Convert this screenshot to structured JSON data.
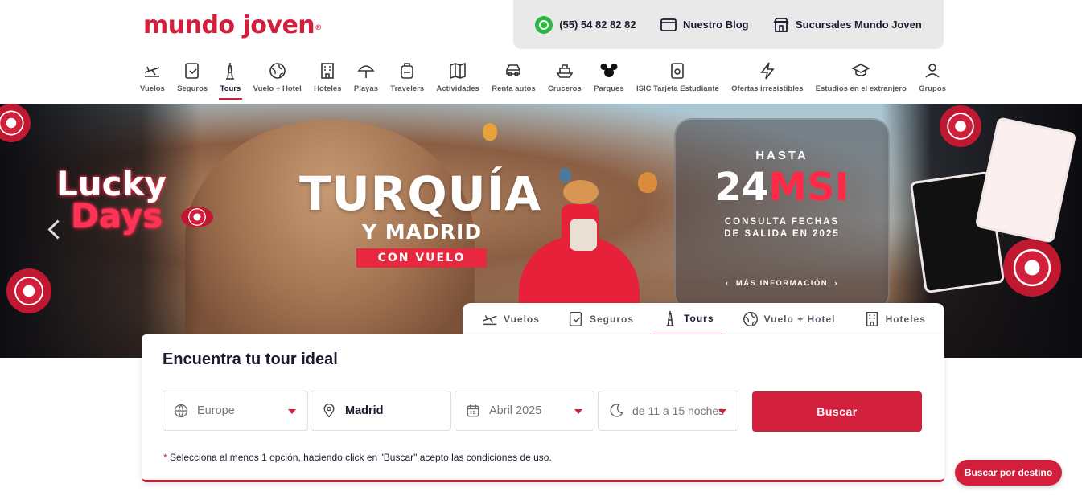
{
  "brand": {
    "logo_text": "mundo joven",
    "registered": "®"
  },
  "topbar": {
    "phone": "(55) 54 82 82 82",
    "blog": "Nuestro Blog",
    "branches": "Sucursales Mundo Joven"
  },
  "nav": {
    "items": [
      {
        "label": "Vuelos",
        "icon": "plane-icon"
      },
      {
        "label": "Seguros",
        "icon": "insurance-icon"
      },
      {
        "label": "Tours",
        "icon": "eiffel-tower-icon",
        "active": true
      },
      {
        "label": "Vuelo + Hotel",
        "icon": "globe-icon"
      },
      {
        "label": "Hoteles",
        "icon": "hotel-icon"
      },
      {
        "label": "Playas",
        "icon": "umbrella-icon"
      },
      {
        "label": "Travelers",
        "icon": "backpack-icon"
      },
      {
        "label": "Actividades",
        "icon": "map-icon"
      },
      {
        "label": "Renta autos",
        "icon": "car-icon"
      },
      {
        "label": "Cruceros",
        "icon": "ship-icon"
      },
      {
        "label": "Parques",
        "icon": "mouse-ears-icon"
      },
      {
        "label": "ISIC Tarjeta Estudiante",
        "icon": "student-card-icon"
      },
      {
        "label": "Ofertas irresistibles",
        "icon": "lightning-icon"
      },
      {
        "label": "Estudios en el extranjero",
        "icon": "graduation-cap-icon"
      },
      {
        "label": "Grupos",
        "icon": "group-icon"
      }
    ]
  },
  "hero": {
    "lucky_line1": "Lucky",
    "lucky_line2": "Days",
    "title": "TURQUÍA",
    "subtitle": "Y MADRID",
    "badge": "CON VUELO",
    "promo_top": "HASTA",
    "promo_number": "24",
    "promo_unit": "MSI",
    "promo_text": "CONSULTA FECHAS DE SALIDA EN 2025",
    "promo_link": "MÁS INFORMACIÓN"
  },
  "tabs": [
    {
      "label": "Vuelos",
      "icon": "plane-icon"
    },
    {
      "label": "Seguros",
      "icon": "insurance-icon"
    },
    {
      "label": "Tours",
      "icon": "eiffel-tower-icon",
      "active": true
    },
    {
      "label": "Vuelo + Hotel",
      "icon": "globe-icon"
    },
    {
      "label": "Hoteles",
      "icon": "hotel-icon"
    }
  ],
  "search": {
    "heading": "Encuentra tu tour ideal",
    "region": "Europe",
    "city": "Madrid",
    "month": "Abril 2025",
    "nights": "de 11 a 15 noches",
    "button": "Buscar",
    "note_asterisk": "*",
    "note": "Selecciona al menos 1 opción, haciendo click en \"Buscar\" acepto las condiciones de uso."
  },
  "floating_button": "Buscar por destino",
  "colors": {
    "brand_red": "#d21f3c",
    "text_dark": "#1b1b2f",
    "whatsapp_green": "#2bb741"
  }
}
